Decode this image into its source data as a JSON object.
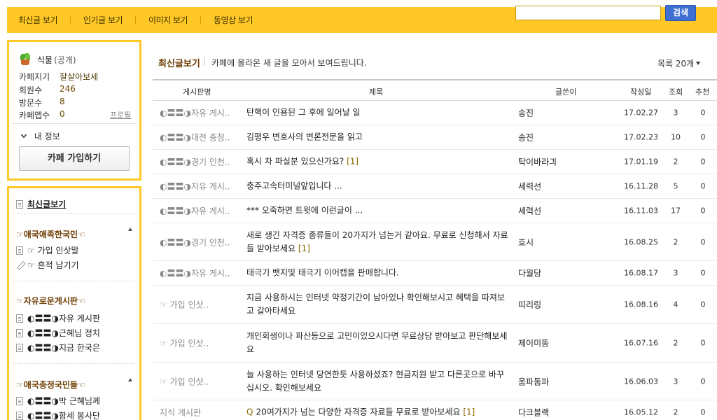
{
  "topnav": {
    "items": [
      "최신글 보기",
      "인기글 보기",
      "이미지 보기",
      "동영상 보기"
    ]
  },
  "search": {
    "button": "검색",
    "placeholder": ""
  },
  "cafe": {
    "name": "식물",
    "visibility": "(공개)",
    "rows": [
      {
        "label": "카페지기",
        "value": "잘살아보세"
      },
      {
        "label": "회원수",
        "value": "246"
      },
      {
        "label": "방문수",
        "value": "8"
      },
      {
        "label": "카페앱수",
        "value": "0"
      }
    ],
    "profile_link": "프로필",
    "my_info": "내 정보",
    "join_button": "카페 가입하기"
  },
  "sidebar": {
    "all_posts": "최신글보기",
    "groups": [
      {
        "title": "☞애국애족한국민☜",
        "items": [
          {
            "label": "☞ 가입 인삿말",
            "icon": "doc"
          },
          {
            "label": "☞ 흔적 남기기",
            "icon": "pencil"
          }
        ]
      },
      {
        "title": "☞자유로운게시판☜",
        "items": [
          {
            "label": "◐〓〓◑자유 게시판",
            "icon": "doc"
          },
          {
            "label": "◐〓〓◑근혜님 정치",
            "icon": "doc"
          },
          {
            "label": "◐〓〓◑지금 한국은",
            "icon": "doc"
          }
        ]
      },
      {
        "title": "☞애국충정국민들☜",
        "items": [
          {
            "label": "◐〓〓◑박 근혜님께",
            "icon": "doc"
          },
          {
            "label": "◐〓〓◑함세 봉사단",
            "icon": "doc"
          }
        ]
      }
    ]
  },
  "main": {
    "title": "최신글보기",
    "description": "카페에 올라온 새 글을 모아서 보여드립니다.",
    "list_count": "목록 20개"
  },
  "table": {
    "headers": {
      "board": "게시판명",
      "title": "제목",
      "author": "글쓴이",
      "date": "작성일",
      "views": "조회",
      "rec": "추천"
    },
    "rows": [
      {
        "board": "◐〓〓◑자유 게시..",
        "title": "탄핵이 인용된 그 후에 일어날 일",
        "count": "",
        "author": "송진",
        "date": "17.02.27",
        "views": "3",
        "rec": "0"
      },
      {
        "board": "◐〓〓◑대전 충청..",
        "title": "김평우 변호사의 변론전문을 읽고",
        "count": "",
        "author": "송진",
        "date": "17.02.23",
        "views": "10",
        "rec": "0"
      },
      {
        "board": "◐〓〓◑경기 인천..",
        "title": "혹시 차 파실분 있으신가요? ",
        "count": "[1]",
        "author": "탁이바라긔",
        "date": "17.01.19",
        "views": "2",
        "rec": "0"
      },
      {
        "board": "◐〓〓◑자유 게시..",
        "title": "충주고속터미널앞입니다 ...",
        "count": "",
        "author": "세력선",
        "date": "16.11.28",
        "views": "5",
        "rec": "0"
      },
      {
        "board": "◐〓〓◑자유 게시..",
        "title": "*** 오죽하면 트윗에 이런글이 ...",
        "count": "",
        "author": "세력선",
        "date": "16.11.03",
        "views": "17",
        "rec": "0"
      },
      {
        "board": "◐〓〓◑경기 인천..",
        "title": "새로 생긴 자격증 종류들이 20가지가 넘는거 같아요. 무료로 신청해서 자료들 받아보세요 ",
        "count": "[1]",
        "author": "호시",
        "date": "16.08.25",
        "views": "2",
        "rec": "0"
      },
      {
        "board": "◐〓〓◑자유 게시..",
        "title": "태극기 뱃지및 태극기 이어캡을 판매합니다.",
        "count": "",
        "author": "다월당",
        "date": "16.08.17",
        "views": "3",
        "rec": "0"
      },
      {
        "board": "☞ 가입 인삿..",
        "title": "지금 사용하시는 인터넷 약정기간이 남아있나 확인해보시고 혜택을 따져보고 갈아타세요",
        "count": "",
        "author": "띠리링",
        "date": "16.08.16",
        "views": "4",
        "rec": "0"
      },
      {
        "board": "☞ 가입 인삿..",
        "title": "개인회생이나 파산등으로 고민이있으시다면 무료상담 받아보고 판단해보세요",
        "count": "",
        "author": "제이미뚱",
        "date": "16.07.16",
        "views": "2",
        "rec": "0"
      },
      {
        "board": "☞ 가입 인삿..",
        "title": "늘 사용하는 인터넷 당연한듯 사용하셨죠? 현금지원 받고 다른곳으로 바꾸십시오. 확인해보세요",
        "count": "",
        "author": "움파둠파",
        "date": "16.06.03",
        "views": "3",
        "rec": "0"
      },
      {
        "board": "지식 게시판",
        "title": "20여가지가 넘는 다양한 자격증 자료들 무료로 받아보세요 ",
        "count": "[1]",
        "q": "Q",
        "author": "다크블랙",
        "date": "16.05.12",
        "views": "2",
        "rec": "0"
      }
    ]
  },
  "colors": {
    "accent": "#ffc826",
    "search_button": "#3e6fd3",
    "category_title": "#6b3b00"
  }
}
